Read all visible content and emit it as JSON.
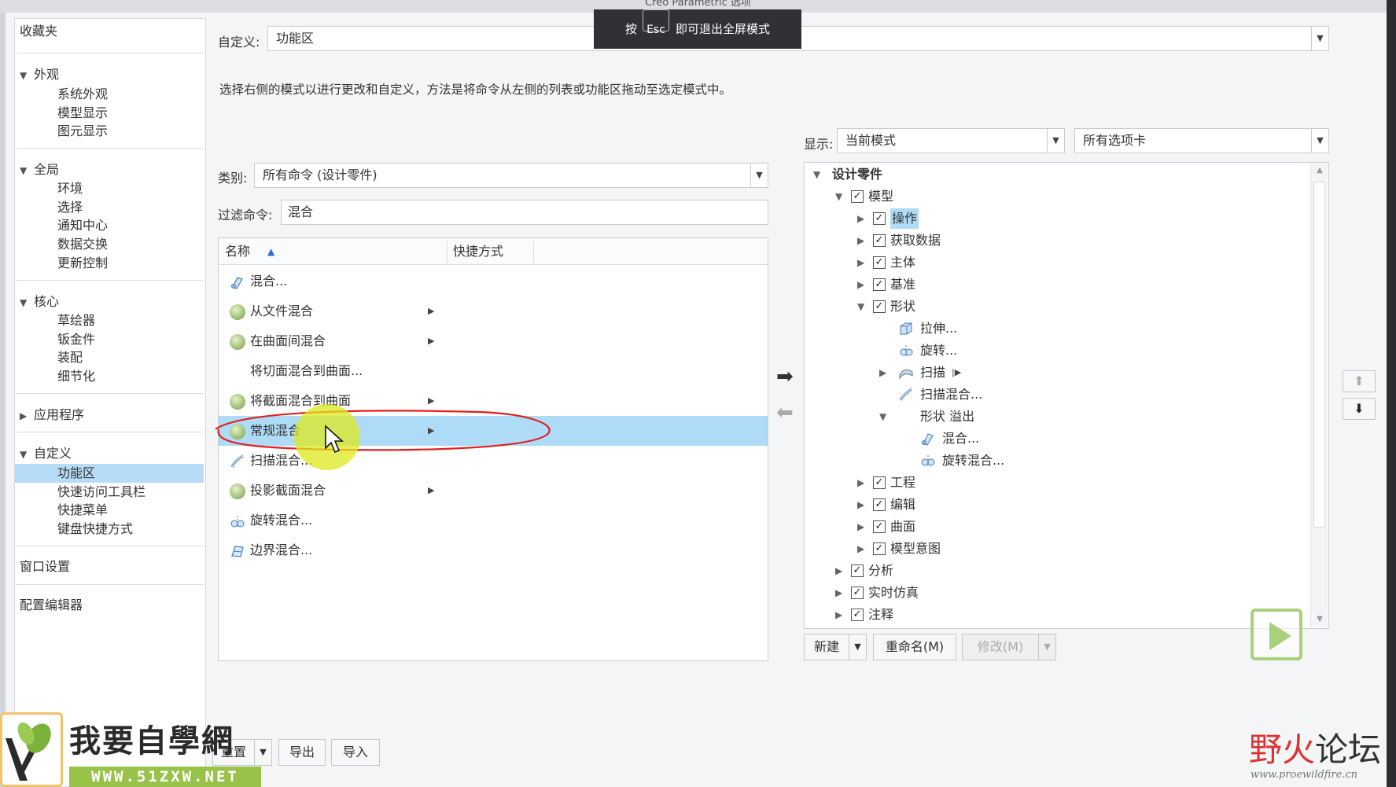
{
  "window": {
    "title": "Creo Parametric 选项"
  },
  "fullscreen_toast": {
    "prefix": "按",
    "key": "Esc",
    "suffix": "即可退出全屏模式"
  },
  "nav": {
    "favorites": "收藏夹",
    "sections": [
      {
        "label": "外观",
        "items": [
          "系统外观",
          "模型显示",
          "图元显示"
        ]
      },
      {
        "label": "全局",
        "items": [
          "环境",
          "选择",
          "通知中心",
          "数据交换",
          "更新控制"
        ]
      },
      {
        "label": "核心",
        "items": [
          "草绘器",
          "钣金件",
          "装配",
          "细节化"
        ]
      },
      {
        "label": "应用程序",
        "items": []
      },
      {
        "label": "自定义",
        "items": [
          "功能区",
          "快速访问工具栏",
          "快捷菜单",
          "键盘快捷方式"
        ]
      }
    ],
    "selected_item": "功能区",
    "window_settings": "窗口设置",
    "config_editor": "配置编辑器"
  },
  "customize": {
    "label": "自定义:",
    "value": "功能区"
  },
  "instruction": "选择右侧的模式以进行更改和自定义，方法是将命令从左侧的列表或功能区拖动至选定模式中。",
  "category": {
    "label": "类别:",
    "value": "所有命令 (设计零件)"
  },
  "filter": {
    "label": "过滤命令:",
    "value": "混合"
  },
  "command_list": {
    "col_name": "名称",
    "col_shortcut": "快捷方式",
    "rows": [
      {
        "label": "混合...",
        "icon": "blend-icon",
        "submenu": false
      },
      {
        "label": "从文件混合",
        "icon": "sphere-icon",
        "submenu": true
      },
      {
        "label": "在曲面间混合",
        "icon": "sphere-icon",
        "submenu": true
      },
      {
        "label": "将切面混合到曲面...",
        "icon": "none",
        "submenu": false
      },
      {
        "label": "将截面混合到曲面",
        "icon": "sphere-icon",
        "submenu": true
      },
      {
        "label": "常规混合",
        "icon": "sphere-icon",
        "submenu": true,
        "selected": true
      },
      {
        "label": "扫描混合...",
        "icon": "swept-blend-icon",
        "submenu": false
      },
      {
        "label": "投影截面混合",
        "icon": "sphere-icon",
        "submenu": true
      },
      {
        "label": "旋转混合...",
        "icon": "rotational-blend-icon",
        "submenu": false
      },
      {
        "label": "边界混合...",
        "icon": "boundary-blend-icon",
        "submenu": false
      }
    ]
  },
  "display": {
    "label": "显示:",
    "mode": "当前模式",
    "tabs": "所有选项卡"
  },
  "tree": {
    "root": "设计零件",
    "model": "模型",
    "model_children": [
      "操作",
      "获取数据",
      "主体",
      "基准",
      "形状"
    ],
    "shape_children": [
      "拉伸...",
      "旋转...",
      "扫描",
      "扫描混合..."
    ],
    "overflow_label": "形状 溢出",
    "overflow_children": [
      "混合...",
      "旋转混合..."
    ],
    "model_tail": [
      "工程",
      "编辑",
      "曲面",
      "模型意图"
    ],
    "top_tail": [
      "分析",
      "实时仿真",
      "注释"
    ]
  },
  "tree_buttons": {
    "new": "新建",
    "rename": "重命名(M)",
    "modify": "修改(M)"
  },
  "bottom_buttons": {
    "reset": "重置",
    "export": "导出",
    "import": "导入"
  },
  "watermark": {
    "logo_text": "我要自學網",
    "logo_url": "WWW.51ZXW.NET",
    "forum_a": "野火",
    "forum_b": "论坛",
    "forum_url": "www.proewildfire.cn"
  }
}
